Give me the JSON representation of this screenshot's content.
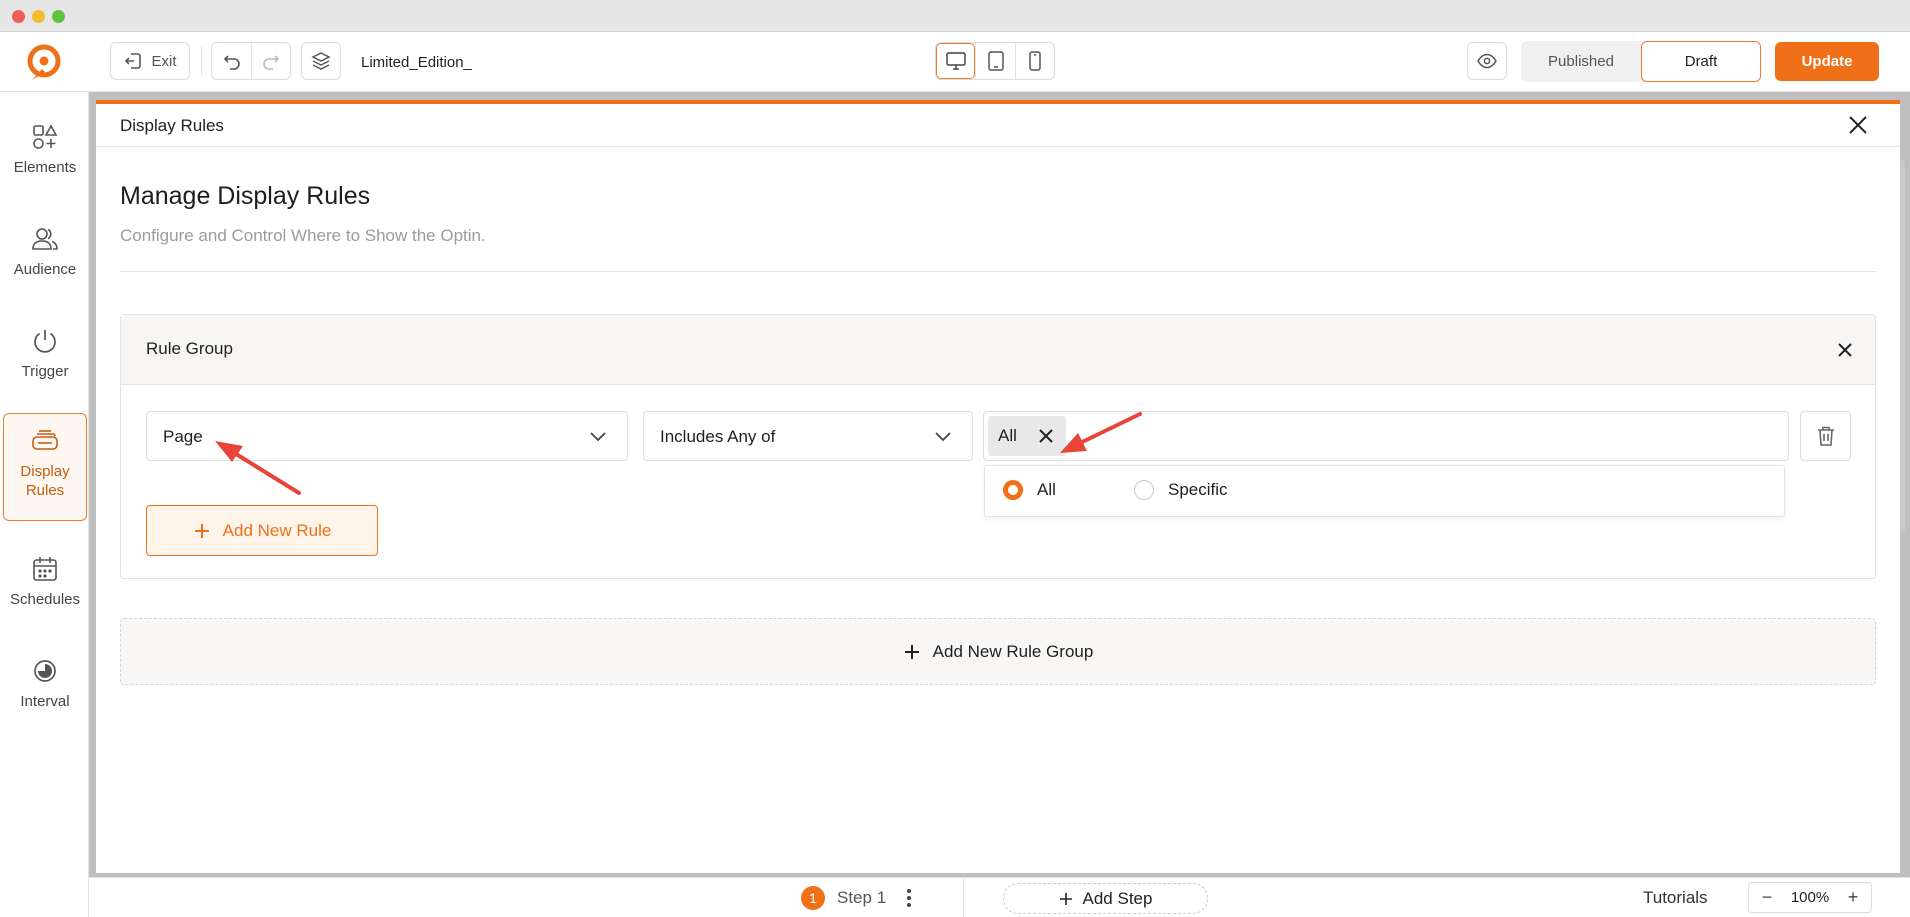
{
  "toolbar": {
    "exit_label": "Exit",
    "doc_title": "Limited_Edition_",
    "status_published": "Published",
    "status_draft": "Draft",
    "update_label": "Update",
    "devices": [
      "desktop-icon",
      "tablet-icon",
      "mobile-icon"
    ],
    "active_device": "desktop"
  },
  "sidebar": {
    "items": [
      {
        "label": "Elements",
        "icon": "elements-icon"
      },
      {
        "label": "Audience",
        "icon": "audience-icon"
      },
      {
        "label": "Trigger",
        "icon": "power-icon"
      },
      {
        "label": "Display Rules",
        "icon": "display-rules-icon",
        "active": true
      },
      {
        "label": "Schedules",
        "icon": "calendar-icon"
      },
      {
        "label": "Interval",
        "icon": "interval-icon"
      }
    ]
  },
  "panel": {
    "title": "Display Rules",
    "heading": "Manage Display Rules",
    "subtitle": "Configure and Control Where to Show the Optin.",
    "rule_group": {
      "title": "Rule Group",
      "rule": {
        "type": "Page",
        "condition": "Includes Any of",
        "tag": "All"
      },
      "options": [
        {
          "label": "All",
          "selected": true
        },
        {
          "label": "Specific",
          "selected": false
        }
      ],
      "add_rule_label": "Add New Rule"
    },
    "add_group_label": "Add New Rule Group"
  },
  "bottom": {
    "step_number": "1",
    "step_label": "Step 1",
    "add_step_label": "Add Step",
    "tutorials_label": "Tutorials",
    "zoom": "100%"
  },
  "colors": {
    "accent": "#ef7018",
    "arrow": "#e8443a"
  }
}
